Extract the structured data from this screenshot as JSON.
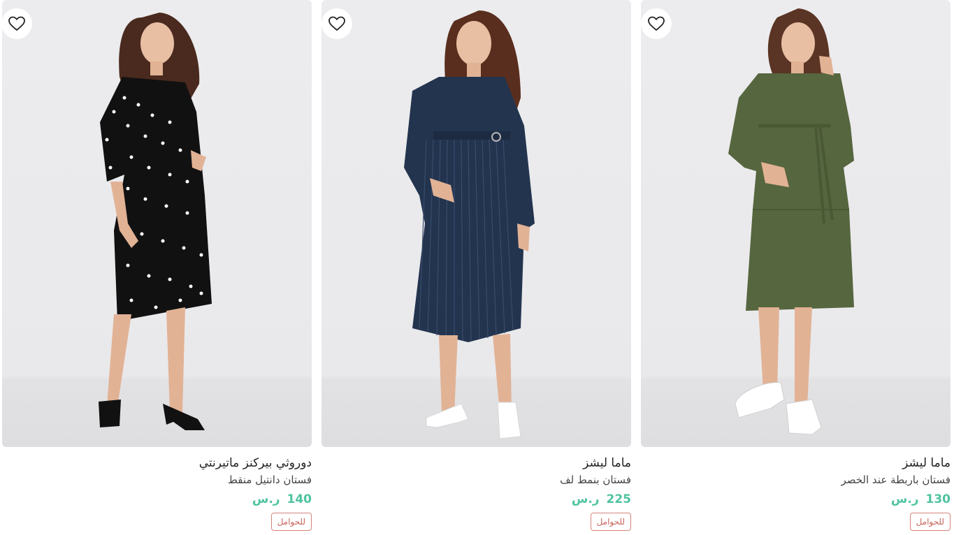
{
  "products": [
    {
      "brand": "دوروثي بيركنز ماتيرنتي",
      "title": "فستان دانتيل منقط",
      "price": "140",
      "currency": "ر.س",
      "badge": "للحوامل",
      "dress_color": "#111111",
      "accent_color": "#ffffff"
    },
    {
      "brand": "ماما ليشز",
      "title": "فستان بنمط لف",
      "price": "225",
      "currency": "ر.س",
      "badge": "للحوامل",
      "dress_color": "#23344f",
      "accent_color": "#3a4c6b"
    },
    {
      "brand": "ماما ليشز",
      "title": "فستان باربطة عند الخصر",
      "price": "130",
      "currency": "ر.س",
      "badge": "للحوامل",
      "dress_color": "#56663f",
      "accent_color": "#4a5934"
    }
  ],
  "colors": {
    "price": "#4fc3a1",
    "badge_border": "#d6847a",
    "badge_text": "#c9645a"
  },
  "icons": {
    "wishlist": "heart-outline-icon"
  }
}
